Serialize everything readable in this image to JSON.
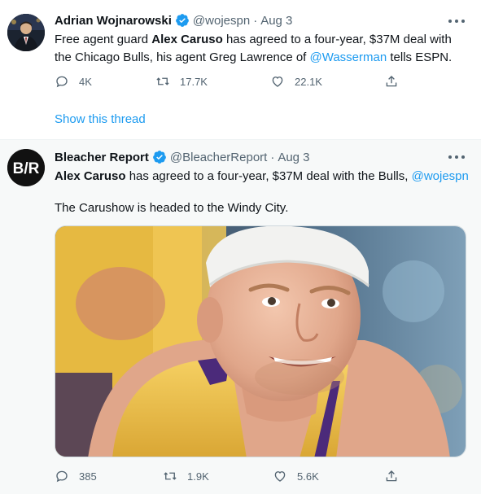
{
  "tweets": [
    {
      "author_name": "Adrian Wojnarowski",
      "handle": "@wojespn",
      "dot": "·",
      "date": "Aug 3",
      "text_parts": [
        "Free agent guard ",
        "Alex Caruso",
        " has agreed to a four-year, $37M deal with the Chicago Bulls, his agent Greg Lawrence of ",
        "@Wasserman",
        " tells ESPN."
      ],
      "replies": "4K",
      "retweets": "17.7K",
      "likes": "22.1K",
      "show_thread": "Show this thread"
    },
    {
      "author_name": "Bleacher Report",
      "handle": "@BleacherReport",
      "dot": "·",
      "date": "Aug 3",
      "avatar_text": "B/R",
      "text_parts": [
        "Alex Caruso",
        " has agreed to a four-year, $37M deal with the Bulls, ",
        "@wojespn"
      ],
      "text2": "The Carushow is headed to the Windy City.",
      "replies": "385",
      "retweets": "1.9K",
      "likes": "5.6K"
    }
  ],
  "colors": {
    "link": "#1d9bf0",
    "verified": "#1d9bf0",
    "secondary_text": "#536471",
    "lakers_gold": "#f4c84a",
    "lakers_purple": "#4b2a7a"
  },
  "icons": [
    "reply-icon",
    "retweet-icon",
    "like-icon",
    "share-icon",
    "more-icon",
    "verified-icon"
  ]
}
